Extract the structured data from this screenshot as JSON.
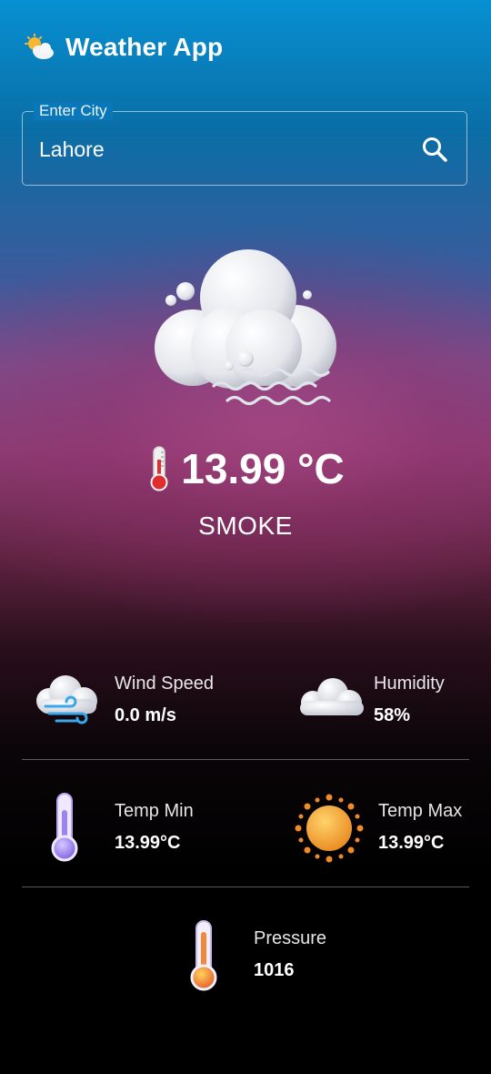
{
  "header": {
    "title": "Weather App",
    "icon": "sun-behind-cloud-icon"
  },
  "search": {
    "legend": "Enter City",
    "value": "Lahore",
    "icon": "search-icon"
  },
  "current": {
    "icon": "smoke-cloud-icon",
    "temperature": "13.99 °C",
    "temperature_icon": "thermometer-icon",
    "condition": "SMOKE"
  },
  "details": {
    "wind": {
      "label": "Wind Speed",
      "value": "0.0 m/s",
      "icon": "windy-cloud-icon"
    },
    "humidity": {
      "label": "Humidity",
      "value": "58%",
      "icon": "cloud-icon"
    },
    "temp_min": {
      "label": "Temp Min",
      "value": "13.99°C",
      "icon": "cold-thermometer-icon"
    },
    "temp_max": {
      "label": "Temp Max",
      "value": "13.99°C",
      "icon": "sun-icon"
    },
    "pressure": {
      "label": "Pressure",
      "value": "1016",
      "icon": "hot-thermometer-icon"
    }
  },
  "colors": {
    "top": "#0790d2",
    "middle": "#8b3d74",
    "bottom": "#000000"
  }
}
